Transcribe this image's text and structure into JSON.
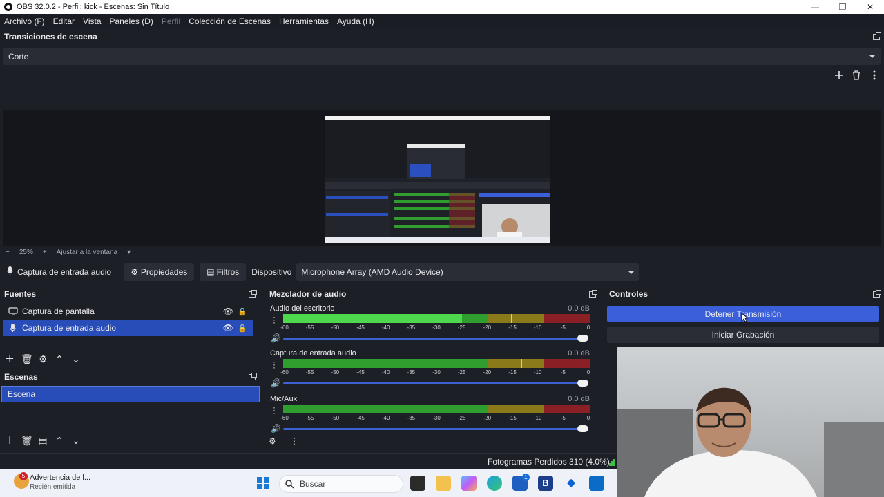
{
  "window": {
    "title": "OBS 32.0.2 - Perfil: kick - Escenas: Sin Título",
    "controls": [
      "—",
      "❐",
      "✕"
    ]
  },
  "menu": [
    {
      "label": "Archivo (F)",
      "enabled": true
    },
    {
      "label": "Editar",
      "enabled": true
    },
    {
      "label": "Vista",
      "enabled": true
    },
    {
      "label": "Paneles (D)",
      "enabled": true
    },
    {
      "label": "Perfil",
      "enabled": false
    },
    {
      "label": "Colección de Escenas",
      "enabled": true
    },
    {
      "label": "Herramientas",
      "enabled": true
    },
    {
      "label": "Ayuda (H)",
      "enabled": true
    }
  ],
  "transitions": {
    "title": "Transiciones de escena",
    "selected": "Corte"
  },
  "preview": {
    "zoom": "25%",
    "fit_label": "Ajustar a la ventana"
  },
  "context": {
    "source_name": "Captura de entrada audio",
    "properties": "Propiedades",
    "filters": "Filtros",
    "device_label": "Dispositivo",
    "device_value": "Microphone Array (AMD Audio Device)"
  },
  "sources": {
    "title": "Fuentes",
    "items": [
      {
        "label": "Captura de pantalla",
        "icon": "monitor-icon",
        "selected": false
      },
      {
        "label": "Captura de entrada audio",
        "icon": "microphone-icon",
        "selected": true
      }
    ]
  },
  "scenes": {
    "title": "Escenas",
    "items": [
      {
        "label": "Escena",
        "selected": true
      }
    ]
  },
  "mixer": {
    "title": "Mezclador de audio",
    "ticks": [
      "-60",
      "-55",
      "-50",
      "-45",
      "-40",
      "-35",
      "-30",
      "-25",
      "-20",
      "-15",
      "-10",
      "-5",
      "0"
    ],
    "channels": [
      {
        "name": "Audio del escritorio",
        "db": "0.0 dB",
        "level_db": -25
      },
      {
        "name": "Captura de entrada audio",
        "db": "0.0 dB",
        "level_db": -60
      },
      {
        "name": "Mic/Aux",
        "db": "0.0 dB",
        "level_db": -60
      }
    ]
  },
  "controls": {
    "title": "Controles",
    "stop_stream": "Detener Transmisión",
    "start_recording": "Iniciar Grabación"
  },
  "status": {
    "dropped_frames": "Fotogramas Perdidos 310 (4.0%)"
  },
  "taskbar": {
    "notification_title": "Advertencia de l...",
    "notification_subtitle": "Recién emitida",
    "notification_badge": "5",
    "search_placeholder": "Buscar",
    "store_badge": "1"
  },
  "colors": {
    "accent": "#284cb8",
    "stop_button": "#3a5fd9",
    "meter_green": "#2f9e2f",
    "meter_green_active": "#4ed84e",
    "meter_yellow": "#8a7a1a",
    "meter_red": "#8a1f26"
  }
}
